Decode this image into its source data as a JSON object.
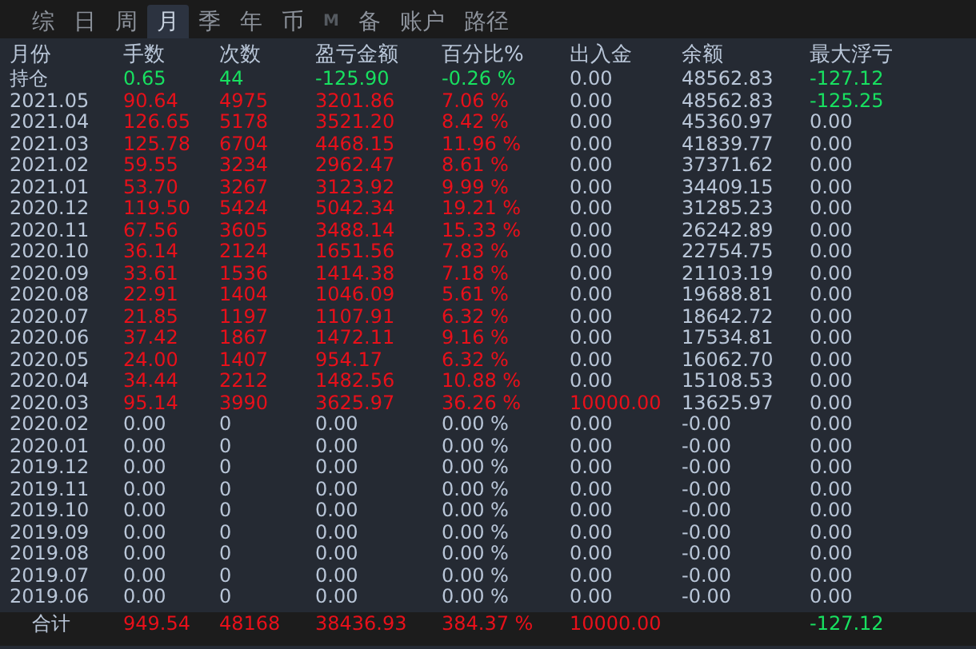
{
  "tabs": [
    {
      "label": "综",
      "selected": false,
      "disabled": false
    },
    {
      "label": "日",
      "selected": false,
      "disabled": false
    },
    {
      "label": "周",
      "selected": false,
      "disabled": false
    },
    {
      "label": "月",
      "selected": true,
      "disabled": false
    },
    {
      "label": "季",
      "selected": false,
      "disabled": false
    },
    {
      "label": "年",
      "selected": false,
      "disabled": false
    },
    {
      "label": "币",
      "selected": false,
      "disabled": false
    },
    {
      "label": "M",
      "selected": false,
      "disabled": true
    },
    {
      "label": "备",
      "selected": false,
      "disabled": false
    },
    {
      "label": "账户",
      "selected": false,
      "disabled": false
    },
    {
      "label": "路径",
      "selected": false,
      "disabled": false
    }
  ],
  "table": {
    "columns": [
      "月份",
      "手数",
      "次数",
      "盈亏金额",
      "百分比%",
      "出入金",
      "余额",
      "最大浮亏"
    ],
    "rows": [
      {
        "cells": [
          {
            "text": "持仓"
          },
          {
            "text": "0.65",
            "color": "#18e060"
          },
          {
            "text": "44",
            "color": "#18e060"
          },
          {
            "text": "-125.90",
            "color": "#18e060"
          },
          {
            "text": "-0.26 %",
            "color": "#18e060"
          },
          {
            "text": "0.00"
          },
          {
            "text": "48562.83"
          },
          {
            "text": "-127.12",
            "color": "#18e060"
          }
        ]
      },
      {
        "cells": [
          {
            "text": "2021.05"
          },
          {
            "text": "90.64",
            "color": "#e8101a"
          },
          {
            "text": "4975",
            "color": "#e8101a"
          },
          {
            "text": "3201.86",
            "color": "#e8101a"
          },
          {
            "text": "7.06 %",
            "color": "#e8101a"
          },
          {
            "text": "0.00"
          },
          {
            "text": "48562.83"
          },
          {
            "text": "-125.25",
            "color": "#18e060"
          }
        ]
      },
      {
        "cells": [
          {
            "text": "2021.04"
          },
          {
            "text": "126.65",
            "color": "#e8101a"
          },
          {
            "text": "5178",
            "color": "#e8101a"
          },
          {
            "text": "3521.20",
            "color": "#e8101a"
          },
          {
            "text": "8.42 %",
            "color": "#e8101a"
          },
          {
            "text": "0.00"
          },
          {
            "text": "45360.97"
          },
          {
            "text": "0.00"
          }
        ]
      },
      {
        "cells": [
          {
            "text": "2021.03"
          },
          {
            "text": "125.78",
            "color": "#e8101a"
          },
          {
            "text": "6704",
            "color": "#e8101a"
          },
          {
            "text": "4468.15",
            "color": "#e8101a"
          },
          {
            "text": "11.96 %",
            "color": "#e8101a"
          },
          {
            "text": "0.00"
          },
          {
            "text": "41839.77"
          },
          {
            "text": "0.00"
          }
        ]
      },
      {
        "cells": [
          {
            "text": "2021.02"
          },
          {
            "text": "59.55",
            "color": "#e8101a"
          },
          {
            "text": "3234",
            "color": "#e8101a"
          },
          {
            "text": "2962.47",
            "color": "#e8101a"
          },
          {
            "text": "8.61 %",
            "color": "#e8101a"
          },
          {
            "text": "0.00"
          },
          {
            "text": "37371.62"
          },
          {
            "text": "0.00"
          }
        ]
      },
      {
        "cells": [
          {
            "text": "2021.01"
          },
          {
            "text": "53.70",
            "color": "#e8101a"
          },
          {
            "text": "3267",
            "color": "#e8101a"
          },
          {
            "text": "3123.92",
            "color": "#e8101a"
          },
          {
            "text": "9.99 %",
            "color": "#e8101a"
          },
          {
            "text": "0.00"
          },
          {
            "text": "34409.15"
          },
          {
            "text": "0.00"
          }
        ]
      },
      {
        "cells": [
          {
            "text": "2020.12"
          },
          {
            "text": "119.50",
            "color": "#e8101a"
          },
          {
            "text": "5424",
            "color": "#e8101a"
          },
          {
            "text": "5042.34",
            "color": "#e8101a"
          },
          {
            "text": "19.21 %",
            "color": "#e8101a"
          },
          {
            "text": "0.00"
          },
          {
            "text": "31285.23"
          },
          {
            "text": "0.00"
          }
        ]
      },
      {
        "cells": [
          {
            "text": "2020.11"
          },
          {
            "text": "67.56",
            "color": "#e8101a"
          },
          {
            "text": "3605",
            "color": "#e8101a"
          },
          {
            "text": "3488.14",
            "color": "#e8101a"
          },
          {
            "text": "15.33 %",
            "color": "#e8101a"
          },
          {
            "text": "0.00"
          },
          {
            "text": "26242.89"
          },
          {
            "text": "0.00"
          }
        ]
      },
      {
        "cells": [
          {
            "text": "2020.10"
          },
          {
            "text": "36.14",
            "color": "#e8101a"
          },
          {
            "text": "2124",
            "color": "#e8101a"
          },
          {
            "text": "1651.56",
            "color": "#e8101a"
          },
          {
            "text": "7.83 %",
            "color": "#e8101a"
          },
          {
            "text": "0.00"
          },
          {
            "text": "22754.75"
          },
          {
            "text": "0.00"
          }
        ]
      },
      {
        "cells": [
          {
            "text": "2020.09"
          },
          {
            "text": "33.61",
            "color": "#e8101a"
          },
          {
            "text": "1536",
            "color": "#e8101a"
          },
          {
            "text": "1414.38",
            "color": "#e8101a"
          },
          {
            "text": "7.18 %",
            "color": "#e8101a"
          },
          {
            "text": "0.00"
          },
          {
            "text": "21103.19"
          },
          {
            "text": "0.00"
          }
        ]
      },
      {
        "cells": [
          {
            "text": "2020.08"
          },
          {
            "text": "22.91",
            "color": "#e8101a"
          },
          {
            "text": "1404",
            "color": "#e8101a"
          },
          {
            "text": "1046.09",
            "color": "#e8101a"
          },
          {
            "text": "5.61 %",
            "color": "#e8101a"
          },
          {
            "text": "0.00"
          },
          {
            "text": "19688.81"
          },
          {
            "text": "0.00"
          }
        ]
      },
      {
        "cells": [
          {
            "text": "2020.07"
          },
          {
            "text": "21.85",
            "color": "#e8101a"
          },
          {
            "text": "1197",
            "color": "#e8101a"
          },
          {
            "text": "1107.91",
            "color": "#e8101a"
          },
          {
            "text": "6.32 %",
            "color": "#e8101a"
          },
          {
            "text": "0.00"
          },
          {
            "text": "18642.72"
          },
          {
            "text": "0.00"
          }
        ]
      },
      {
        "cells": [
          {
            "text": "2020.06"
          },
          {
            "text": "37.42",
            "color": "#e8101a"
          },
          {
            "text": "1867",
            "color": "#e8101a"
          },
          {
            "text": "1472.11",
            "color": "#e8101a"
          },
          {
            "text": "9.16 %",
            "color": "#e8101a"
          },
          {
            "text": "0.00"
          },
          {
            "text": "17534.81"
          },
          {
            "text": "0.00"
          }
        ]
      },
      {
        "cells": [
          {
            "text": "2020.05"
          },
          {
            "text": "24.00",
            "color": "#e8101a"
          },
          {
            "text": "1407",
            "color": "#e8101a"
          },
          {
            "text": "954.17",
            "color": "#e8101a"
          },
          {
            "text": "6.32 %",
            "color": "#e8101a"
          },
          {
            "text": "0.00"
          },
          {
            "text": "16062.70"
          },
          {
            "text": "0.00"
          }
        ]
      },
      {
        "cells": [
          {
            "text": "2020.04"
          },
          {
            "text": "34.44",
            "color": "#e8101a"
          },
          {
            "text": "2212",
            "color": "#e8101a"
          },
          {
            "text": "1482.56",
            "color": "#e8101a"
          },
          {
            "text": "10.88 %",
            "color": "#e8101a"
          },
          {
            "text": "0.00"
          },
          {
            "text": "15108.53"
          },
          {
            "text": "0.00"
          }
        ]
      },
      {
        "cells": [
          {
            "text": "2020.03"
          },
          {
            "text": "95.14",
            "color": "#e8101a"
          },
          {
            "text": "3990",
            "color": "#e8101a"
          },
          {
            "text": "3625.97",
            "color": "#e8101a"
          },
          {
            "text": "36.26 %",
            "color": "#e8101a"
          },
          {
            "text": "10000.00",
            "color": "#e8101a"
          },
          {
            "text": "13625.97"
          },
          {
            "text": "0.00"
          }
        ]
      },
      {
        "cells": [
          {
            "text": "2020.02"
          },
          {
            "text": "0.00"
          },
          {
            "text": "0"
          },
          {
            "text": "0.00"
          },
          {
            "text": "0.00 %"
          },
          {
            "text": "0.00"
          },
          {
            "text": "-0.00"
          },
          {
            "text": "0.00"
          }
        ]
      },
      {
        "cells": [
          {
            "text": "2020.01"
          },
          {
            "text": "0.00"
          },
          {
            "text": "0"
          },
          {
            "text": "0.00"
          },
          {
            "text": "0.00 %"
          },
          {
            "text": "0.00"
          },
          {
            "text": "-0.00"
          },
          {
            "text": "0.00"
          }
        ]
      },
      {
        "cells": [
          {
            "text": "2019.12"
          },
          {
            "text": "0.00"
          },
          {
            "text": "0"
          },
          {
            "text": "0.00"
          },
          {
            "text": "0.00 %"
          },
          {
            "text": "0.00"
          },
          {
            "text": "-0.00"
          },
          {
            "text": "0.00"
          }
        ]
      },
      {
        "cells": [
          {
            "text": "2019.11"
          },
          {
            "text": "0.00"
          },
          {
            "text": "0"
          },
          {
            "text": "0.00"
          },
          {
            "text": "0.00 %"
          },
          {
            "text": "0.00"
          },
          {
            "text": "-0.00"
          },
          {
            "text": "0.00"
          }
        ]
      },
      {
        "cells": [
          {
            "text": "2019.10"
          },
          {
            "text": "0.00"
          },
          {
            "text": "0"
          },
          {
            "text": "0.00"
          },
          {
            "text": "0.00 %"
          },
          {
            "text": "0.00"
          },
          {
            "text": "-0.00"
          },
          {
            "text": "0.00"
          }
        ]
      },
      {
        "cells": [
          {
            "text": "2019.09"
          },
          {
            "text": "0.00"
          },
          {
            "text": "0"
          },
          {
            "text": "0.00"
          },
          {
            "text": "0.00 %"
          },
          {
            "text": "0.00"
          },
          {
            "text": "-0.00"
          },
          {
            "text": "0.00"
          }
        ]
      },
      {
        "cells": [
          {
            "text": "2019.08"
          },
          {
            "text": "0.00"
          },
          {
            "text": "0"
          },
          {
            "text": "0.00"
          },
          {
            "text": "0.00 %"
          },
          {
            "text": "0.00"
          },
          {
            "text": "-0.00"
          },
          {
            "text": "0.00"
          }
        ]
      },
      {
        "cells": [
          {
            "text": "2019.07"
          },
          {
            "text": "0.00"
          },
          {
            "text": "0"
          },
          {
            "text": "0.00"
          },
          {
            "text": "0.00 %"
          },
          {
            "text": "0.00"
          },
          {
            "text": "-0.00"
          },
          {
            "text": "0.00"
          }
        ]
      },
      {
        "cells": [
          {
            "text": "2019.06"
          },
          {
            "text": "0.00"
          },
          {
            "text": "0"
          },
          {
            "text": "0.00"
          },
          {
            "text": "0.00 %"
          },
          {
            "text": "0.00"
          },
          {
            "text": "-0.00"
          },
          {
            "text": "0.00"
          }
        ]
      }
    ],
    "total": {
      "cells": [
        {
          "text": "合计"
        },
        {
          "text": "949.54",
          "color": "#e8101a"
        },
        {
          "text": "48168",
          "color": "#e8101a"
        },
        {
          "text": "38436.93",
          "color": "#e8101a"
        },
        {
          "text": "384.37 %",
          "color": "#e8101a"
        },
        {
          "text": "10000.00",
          "color": "#e8101a"
        },
        {
          "text": ""
        },
        {
          "text": "-127.12",
          "color": "#18e060"
        }
      ]
    }
  }
}
